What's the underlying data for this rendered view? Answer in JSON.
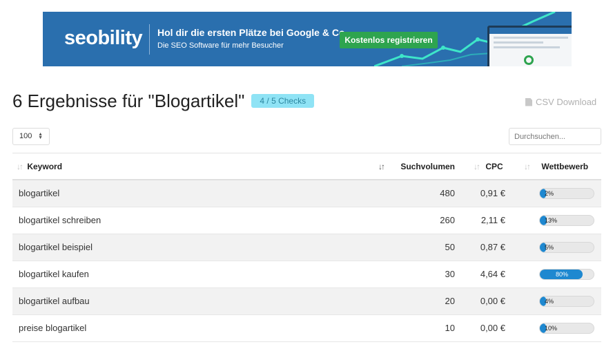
{
  "banner": {
    "logo": "seobility",
    "headline": "Hol dir die ersten Plätze bei Google & Co",
    "subline": "Die SEO Software für mehr Besucher",
    "cta": "Kostenlos registrieren",
    "colors": {
      "background": "#2a6fae",
      "cta": "#2ea44f",
      "line": "#3ee6c9"
    }
  },
  "title": "6 Ergebnisse für \"Blogartikel\"",
  "badge": "4 / 5 Checks",
  "csv_label": "CSV Download",
  "page_size": "100",
  "search": {
    "placeholder": "Durchsuchen..."
  },
  "columns": {
    "keyword": "Keyword",
    "volume": "Suchvolumen",
    "cpc": "CPC",
    "competition": "Wettbewerb"
  },
  "rows": [
    {
      "keyword": "blogartikel",
      "volume": "480",
      "cpc": "0,91 €",
      "competition": "2%",
      "competition_value": 2
    },
    {
      "keyword": "blogartikel schreiben",
      "volume": "260",
      "cpc": "2,11 €",
      "competition": "13%",
      "competition_value": 13
    },
    {
      "keyword": "blogartikel beispiel",
      "volume": "50",
      "cpc": "0,87 €",
      "competition": "5%",
      "competition_value": 5
    },
    {
      "keyword": "blogartikel kaufen",
      "volume": "30",
      "cpc": "4,64 €",
      "competition": "80%",
      "competition_value": 80
    },
    {
      "keyword": "blogartikel aufbau",
      "volume": "20",
      "cpc": "0,00 €",
      "competition": "4%",
      "competition_value": 4
    },
    {
      "keyword": "preise blogartikel",
      "volume": "10",
      "cpc": "0,00 €",
      "competition": "10%",
      "competition_value": 10
    }
  ],
  "accent_color": "#1e88d0",
  "badge_color": "#8fe3f5"
}
